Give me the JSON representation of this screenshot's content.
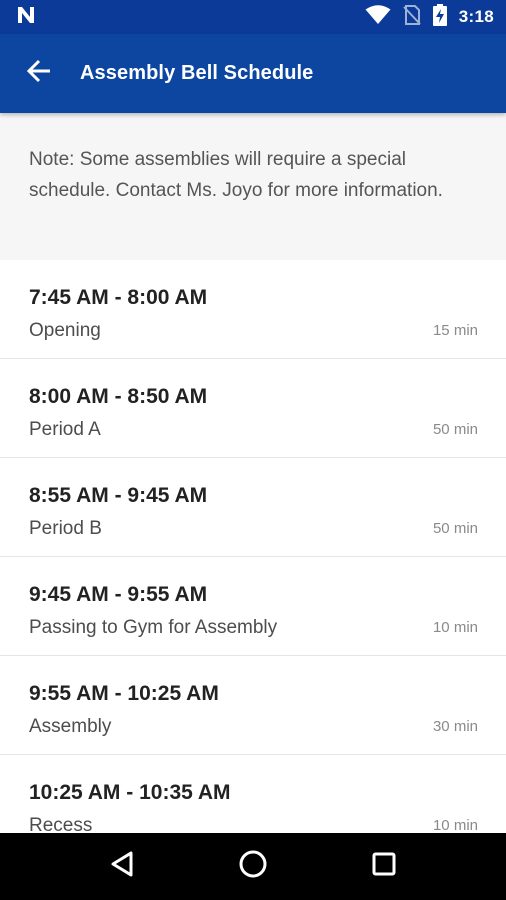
{
  "status_bar": {
    "time": "3:18",
    "icons": [
      "notification-n-icon",
      "wifi-icon",
      "no-sim-icon",
      "battery-charging-icon"
    ]
  },
  "app_bar": {
    "title": "Assembly Bell Schedule",
    "back_icon": "arrow-back-icon"
  },
  "note": {
    "text": "Note: Some assemblies will require a special schedule. Contact Ms. Joyo for more information."
  },
  "schedule": [
    {
      "time": "7:45 AM - 8:00 AM",
      "name": "Opening",
      "duration": "15 min"
    },
    {
      "time": "8:00 AM - 8:50 AM",
      "name": "Period A",
      "duration": "50 min"
    },
    {
      "time": "8:55 AM - 9:45 AM",
      "name": "Period B",
      "duration": "50 min"
    },
    {
      "time": "9:45 AM - 9:55 AM",
      "name": "Passing to Gym for Assembly",
      "duration": "10 min"
    },
    {
      "time": "9:55 AM - 10:25 AM",
      "name": "Assembly",
      "duration": "30 min"
    },
    {
      "time": "10:25 AM - 10:35 AM",
      "name": "Recess",
      "duration": "10 min"
    }
  ],
  "nav_bar": {
    "icons": [
      "back-triangle-icon",
      "home-circle-icon",
      "recents-square-icon"
    ]
  },
  "colors": {
    "status_bar": "#0b3a98",
    "app_bar": "#0d46a0",
    "note_background": "#f6f6f6",
    "nav_bar": "#000000"
  }
}
